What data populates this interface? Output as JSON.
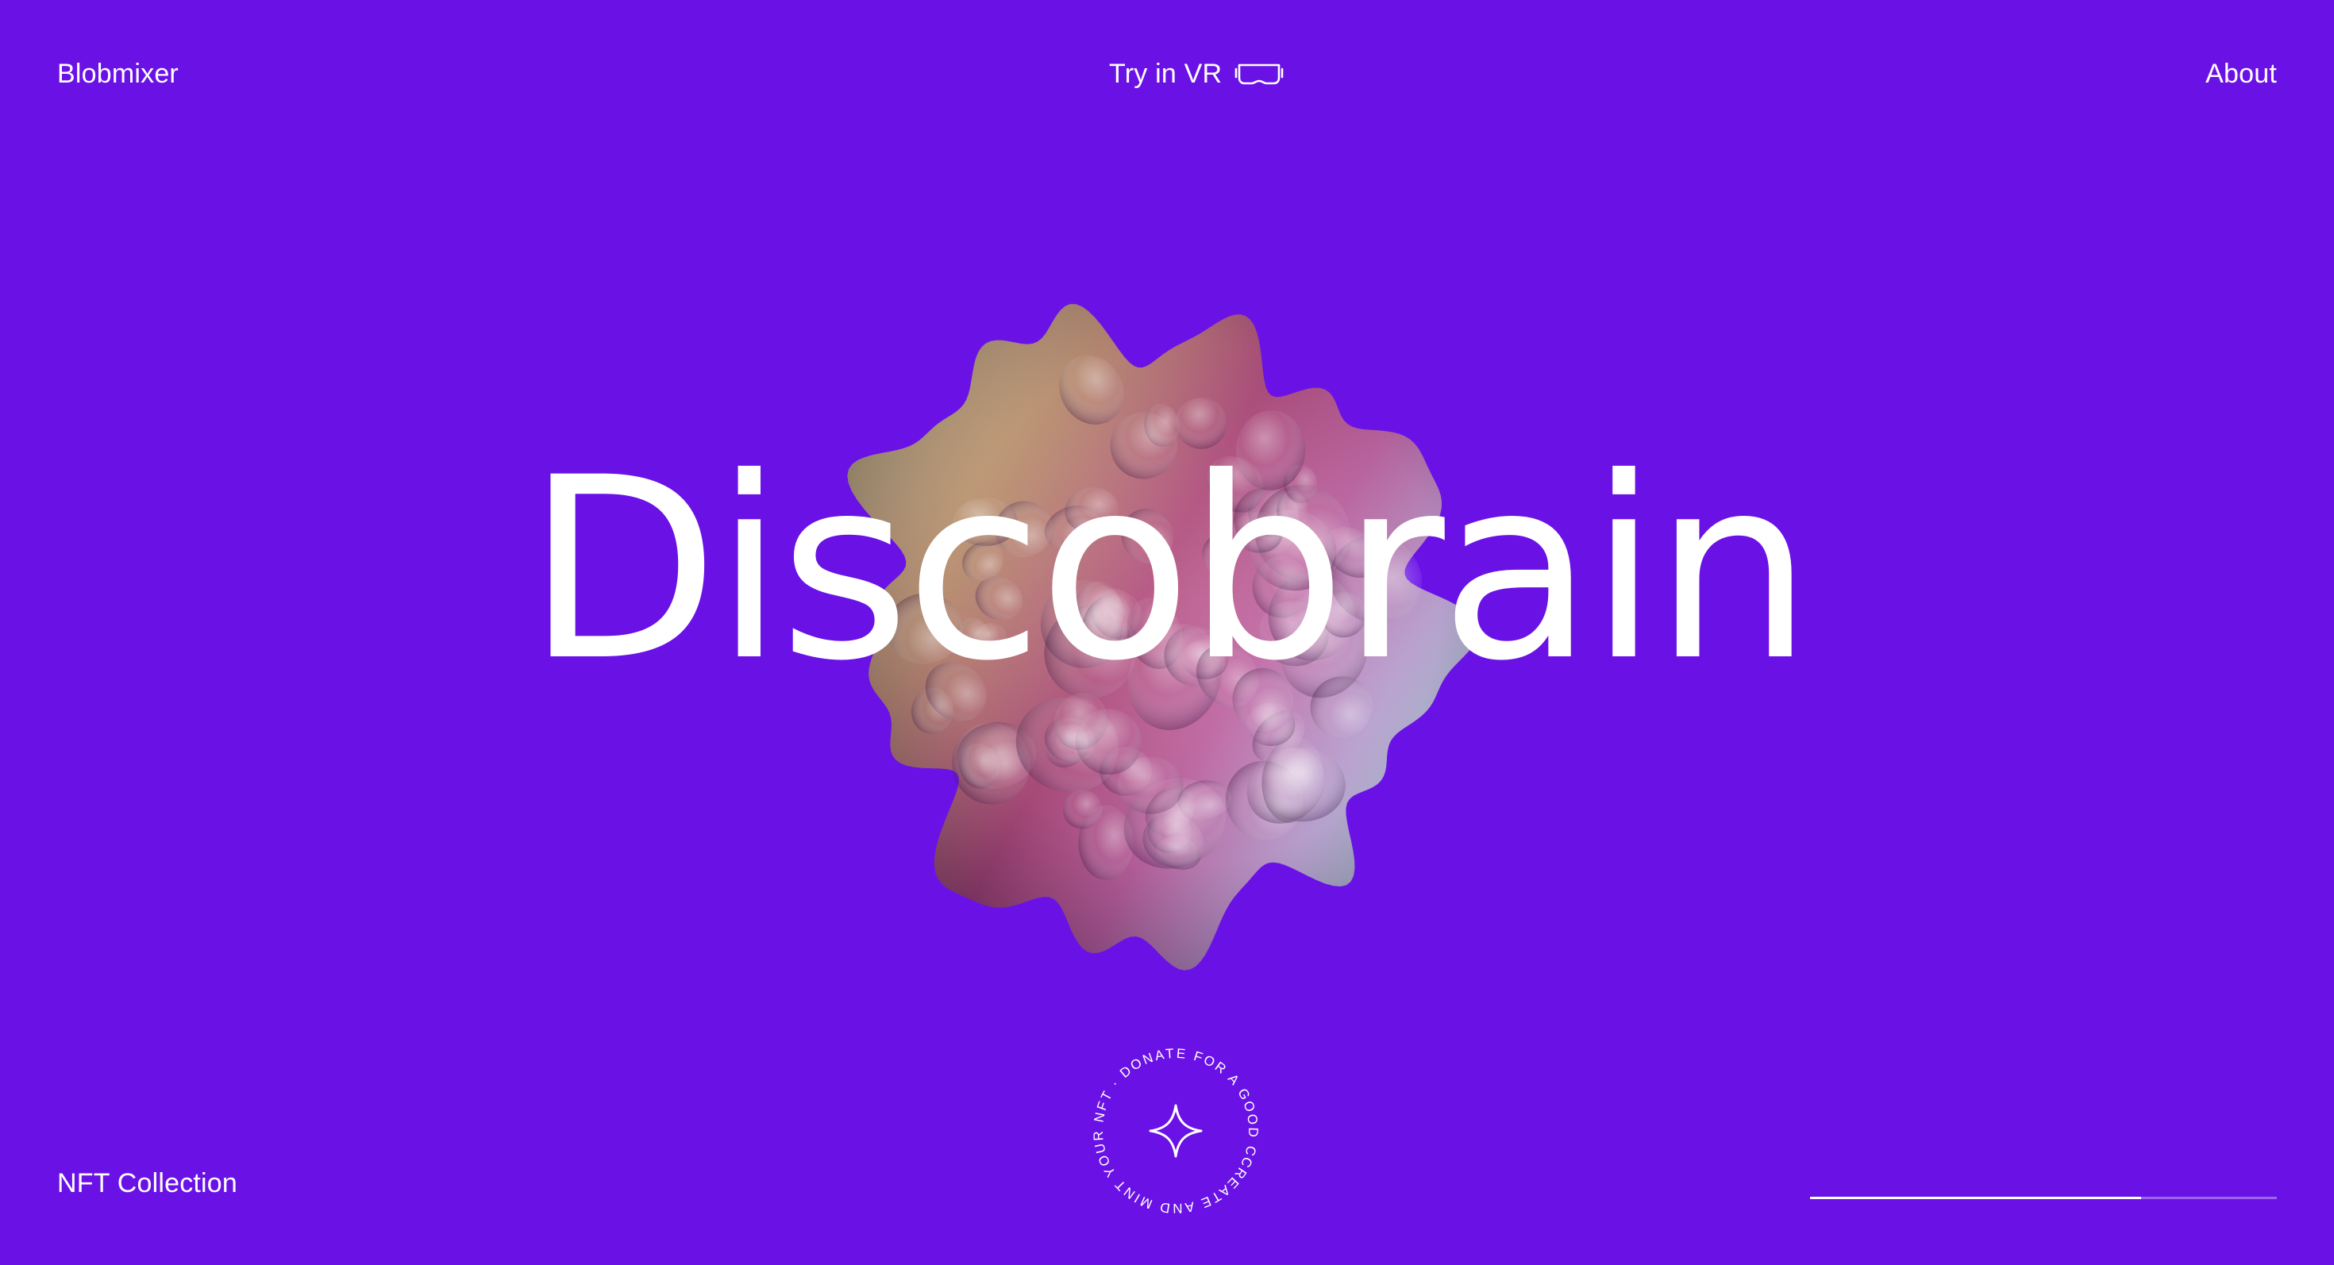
{
  "header": {
    "brand": "Blobmixer",
    "try_vr": "Try in VR",
    "about": "About"
  },
  "hero": {
    "title": "Discobrain"
  },
  "badge": {
    "ring_text": "CREATE AND MINT YOUR NFT · DONATE FOR A GOOD CAUSE ·",
    "icon": "sparkle-icon"
  },
  "footer": {
    "collection_link": "NFT Collection",
    "progress": 0.71
  },
  "colors": {
    "background": "#6a12e6",
    "text": "#ffffff"
  }
}
